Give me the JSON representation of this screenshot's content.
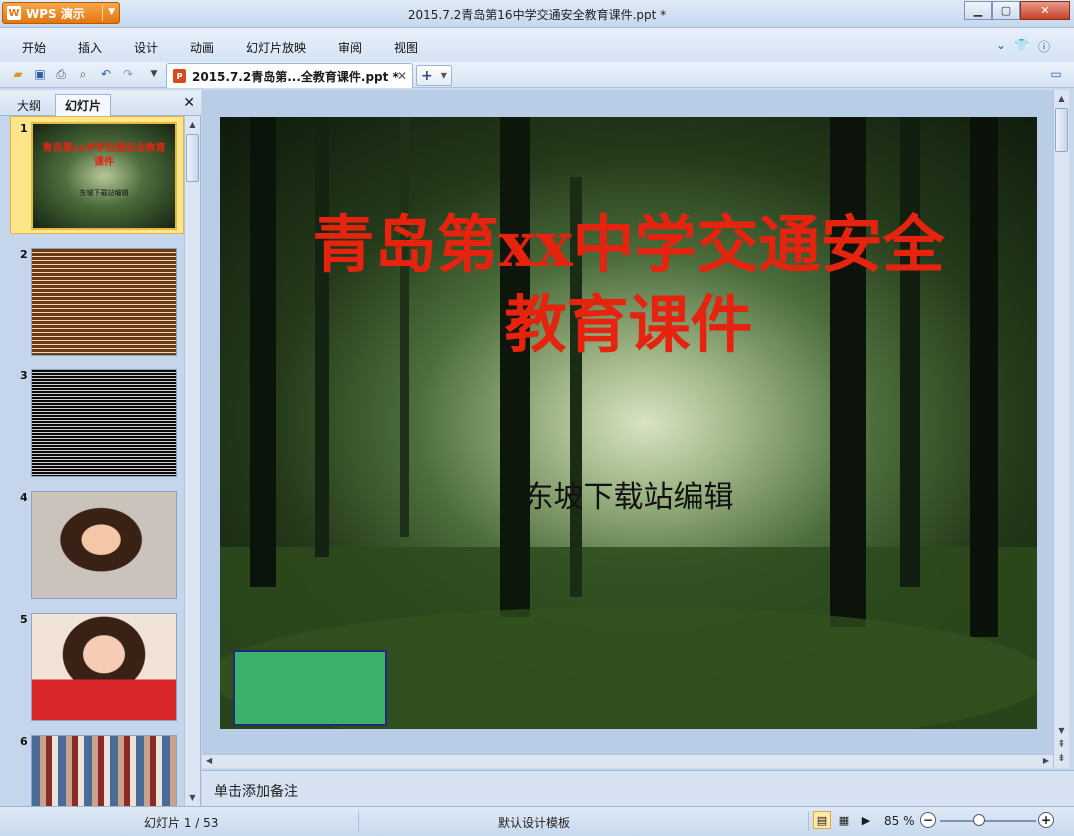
{
  "window": {
    "app_button": "WPS 演示",
    "title": "2015.7.2青岛第16中学交通安全教育课件.ppt *",
    "controls": [
      "minimize",
      "maximize",
      "close"
    ]
  },
  "menu": {
    "items": [
      "开始",
      "插入",
      "设计",
      "动画",
      "幻灯片放映",
      "审阅",
      "视图"
    ],
    "right_icons": [
      "chevron-down-icon",
      "skin-icon",
      "help-icon"
    ]
  },
  "toolbar": {
    "icons": [
      "open-icon",
      "save-icon",
      "print-icon",
      "print-preview-icon",
      "undo-icon",
      "redo-icon",
      "customize-icon"
    ],
    "document_tab": "2015.7.2青岛第...全教育课件.ppt *",
    "new_tab_label": "+"
  },
  "left_panel": {
    "tabs": [
      "大纲",
      "幻灯片"
    ],
    "active_tab": "幻灯片",
    "thumbnails": [
      {
        "num": "1",
        "title": "青岛第xx中学交通安全教育课件",
        "subtitle": "东坡下载站编辑",
        "selected": true
      },
      {
        "num": "2"
      },
      {
        "num": "3"
      },
      {
        "num": "4"
      },
      {
        "num": "5"
      },
      {
        "num": "6"
      }
    ]
  },
  "slide": {
    "title_line1": "青岛第xx中学交通安全",
    "title_line2": "教育课件",
    "subtitle": "东坡下载站编辑",
    "title_color": "#e5230f",
    "box_color": "#3bb16c"
  },
  "notes": {
    "placeholder": "单击添加备注"
  },
  "status": {
    "slide_counter": "幻灯片 1 / 53",
    "template": "默认设计模板",
    "zoom": "85 %"
  }
}
